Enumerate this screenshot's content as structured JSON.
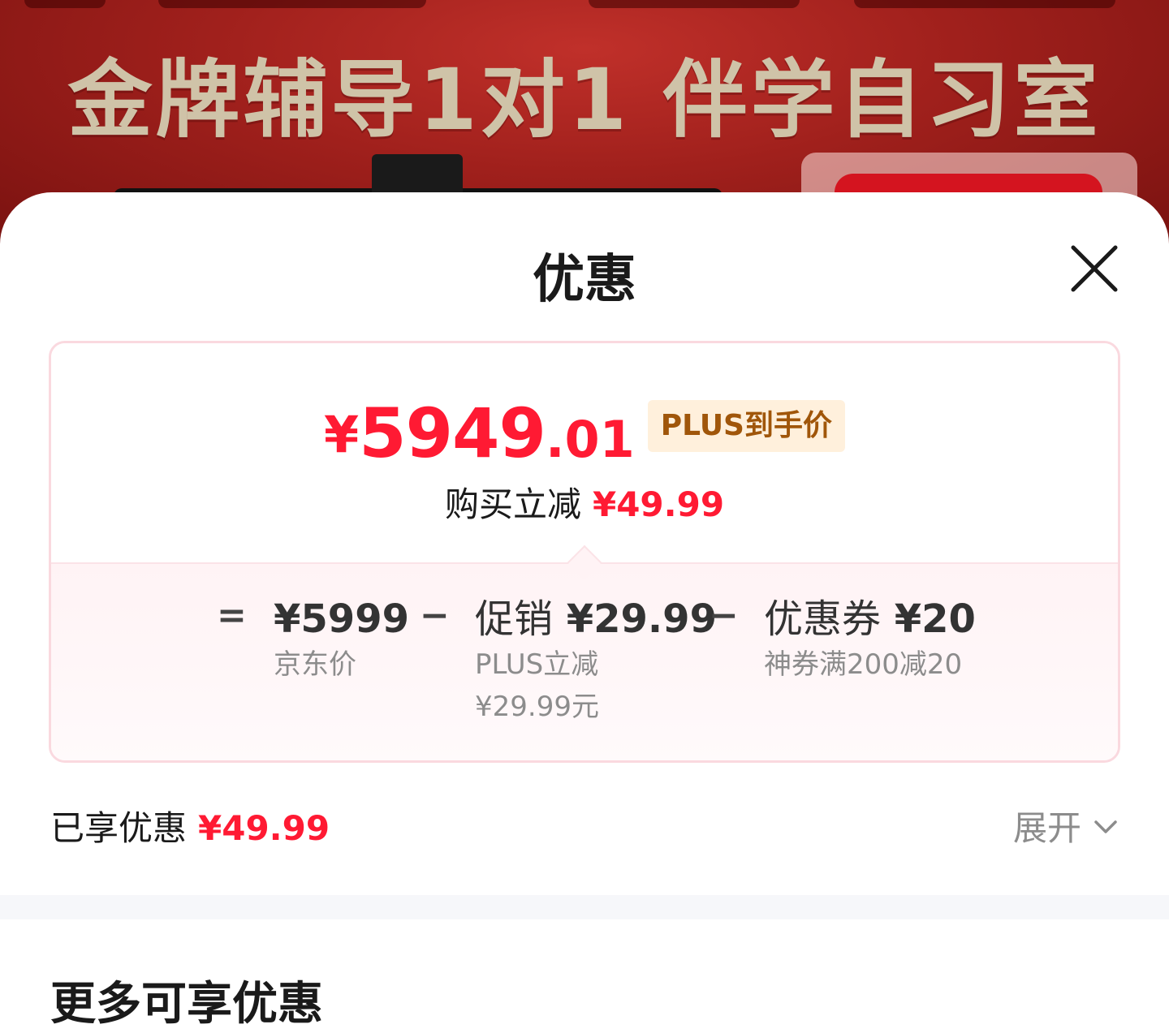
{
  "banner": {
    "title": "金牌辅导1对1 伴学自习室"
  },
  "sheet": {
    "title": "优惠",
    "close_icon": "close-icon"
  },
  "price_card": {
    "final_price": {
      "currency": "¥",
      "integer": "5949",
      "decimal": ".01",
      "badge": "PLUS到手价"
    },
    "reduce": {
      "label": "购买立减",
      "value": "¥49.99"
    },
    "breakdown": {
      "equals": "=",
      "jd_price": {
        "value": "¥5999",
        "label": "京东价"
      },
      "minus_1": "−",
      "promo": {
        "label": "促销",
        "value": "¥29.99",
        "sub1": "PLUS立减",
        "sub2": "¥29.99元"
      },
      "minus_2": "−",
      "coupon": {
        "label": "优惠券",
        "value": "¥20",
        "sub1": "神券满200减20"
      }
    }
  },
  "enjoyed": {
    "label": "已享优惠",
    "value": "¥49.99",
    "expand_label": "展开",
    "expand_icon": "chevron-down-icon"
  },
  "more": {
    "title": "更多可享优惠"
  },
  "colors": {
    "accent_red": "#ff1a33",
    "badge_bg": "#fff0dc",
    "badge_text": "#a0560a",
    "card_border": "#fad9df"
  }
}
